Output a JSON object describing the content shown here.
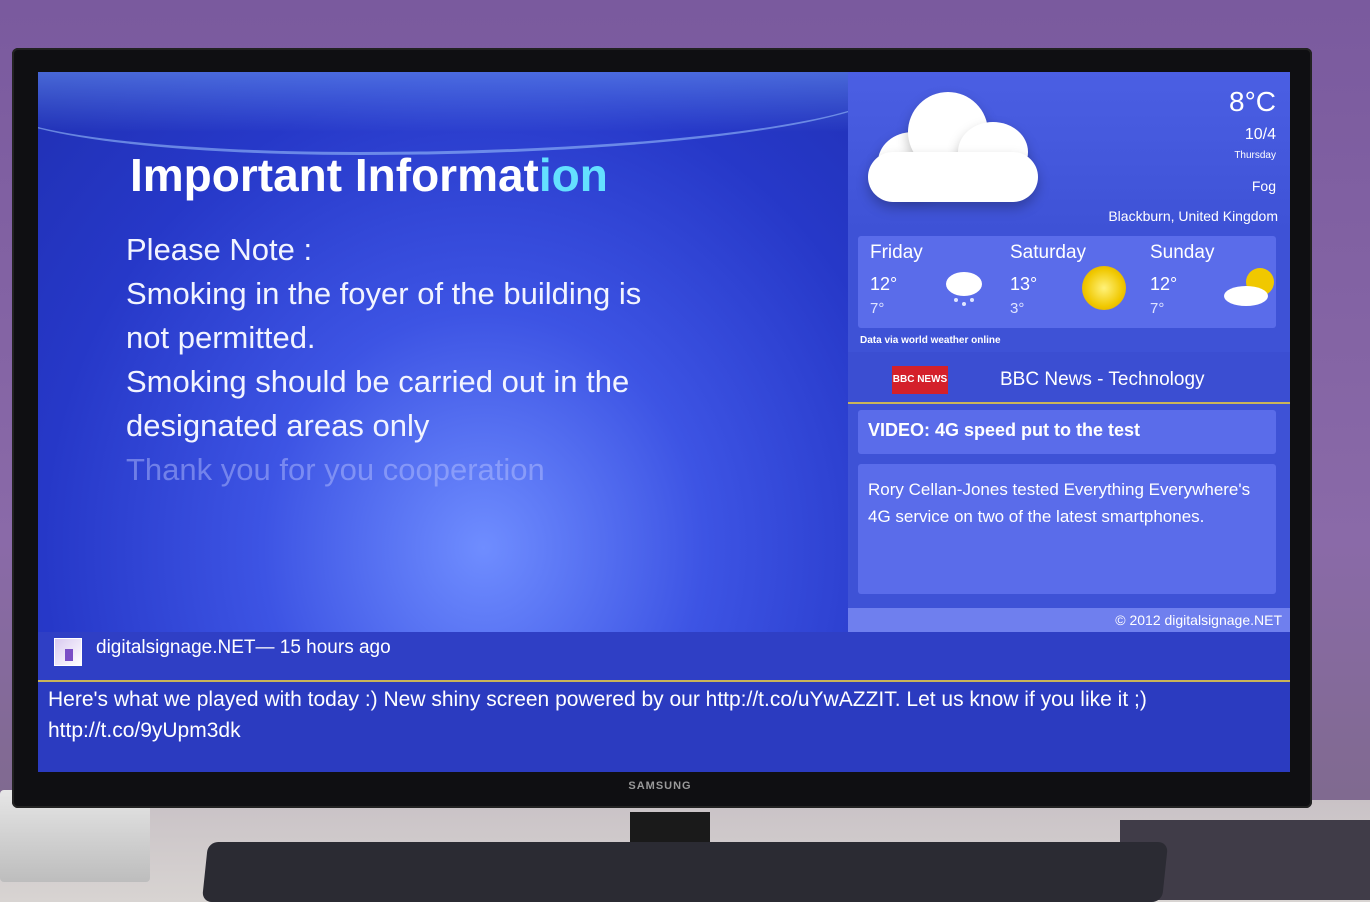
{
  "slide": {
    "title_main": "Important Informat",
    "title_tail": "ion",
    "lines": [
      "Please Note :",
      "Smoking in the foyer of the building is",
      "not permitted.",
      "Smoking should be carried out in the",
      "designated areas only"
    ],
    "faded_line": "Thank you for you cooperation"
  },
  "weather": {
    "current_temp": "8°C",
    "date": "10/4",
    "day": "Thursday",
    "condition": "Fog",
    "location": "Blackburn, United Kingdom",
    "forecast": [
      {
        "day": "Friday",
        "high": "12°",
        "low": "7°",
        "icon": "snow-cloud-icon"
      },
      {
        "day": "Saturday",
        "high": "13°",
        "low": "3°",
        "icon": "sun-icon"
      },
      {
        "day": "Sunday",
        "high": "12°",
        "low": "7°",
        "icon": "sun-cloud-icon"
      }
    ],
    "attribution": "Data via world weather online"
  },
  "news": {
    "logo_text": "BBC NEWS",
    "title": "BBC News - Technology",
    "headline": "VIDEO: 4G speed put to the test",
    "summary": "Rory Cellan-Jones tested Everything Everywhere's 4G service on two of the latest smartphones."
  },
  "footer": {
    "copyright": "© 2012 digitalsignage.NET"
  },
  "ticker": {
    "source": "digitalsignage.NET— 15 hours ago",
    "message": "Here's what we played with today :) New shiny screen powered by our http://t.co/uYwAZZIT. Let us know if you like it ;) http://t.co/9yUpm3dk"
  },
  "tv": {
    "brand": "SAMSUNG"
  }
}
